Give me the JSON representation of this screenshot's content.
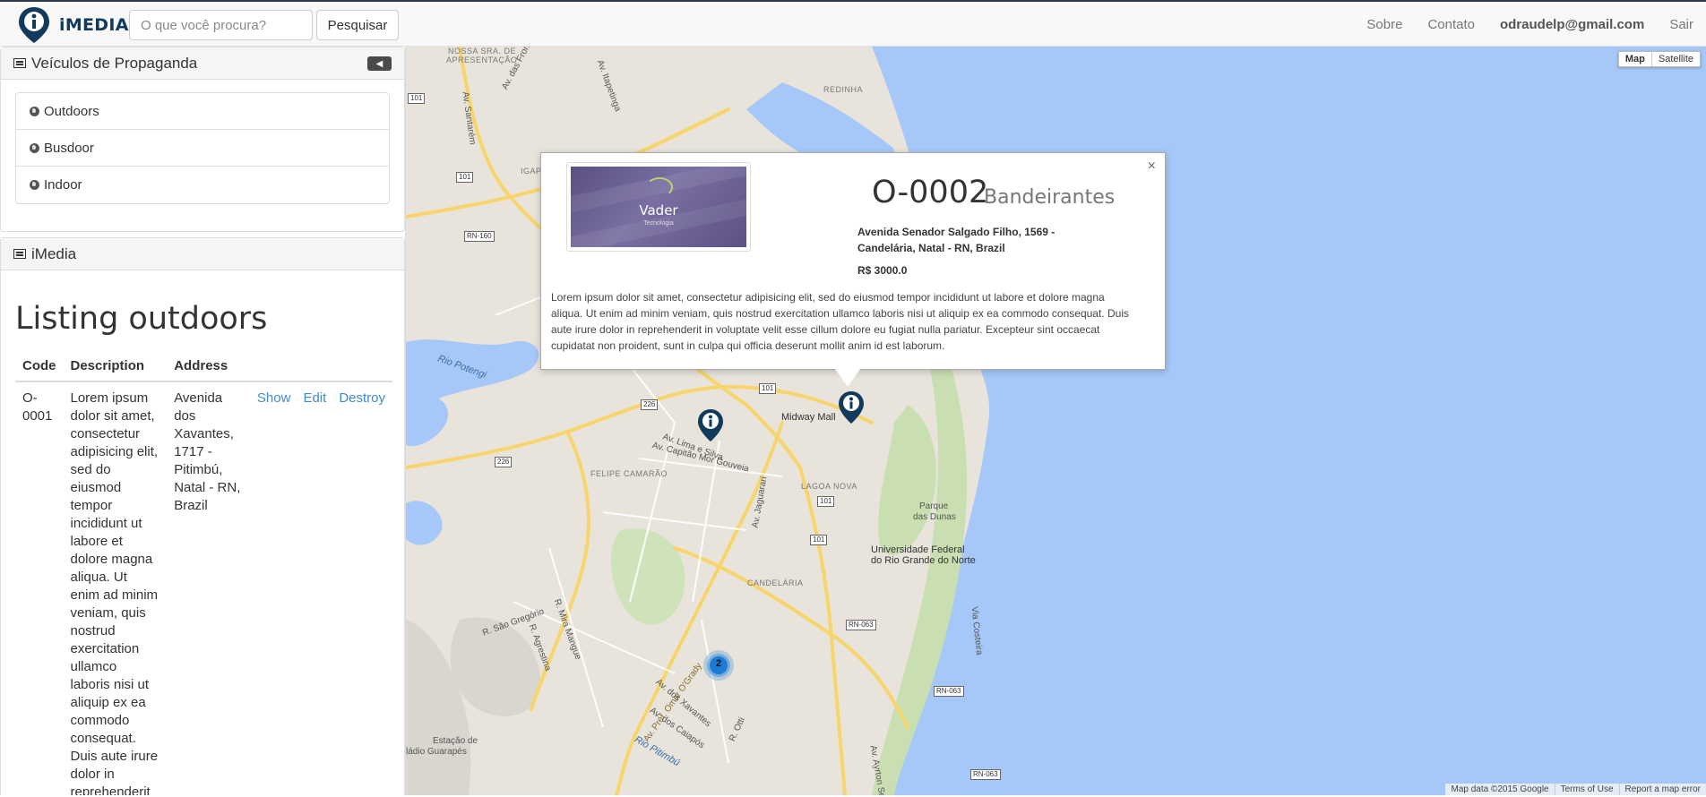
{
  "navbar": {
    "logo_text": "iMEDIA",
    "search_placeholder": "O que você procura?",
    "search_button": "Pesquisar",
    "links": {
      "about": "Sobre",
      "contact": "Contato",
      "user": "odraudelp@gmail.com",
      "logout": "Sair"
    }
  },
  "sidebar": {
    "vehicles_panel_title": "Veículos de Propaganda",
    "vehicles": [
      "Outdoors",
      "Busdoor",
      "Indoor"
    ],
    "imedia_panel_title": "iMedia",
    "page_title": "Listing outdoors",
    "table": {
      "headers": {
        "code": "Code",
        "description": "Description",
        "address": "Address"
      },
      "rows": [
        {
          "code": "O-0001",
          "description": "Lorem ipsum dolor sit amet, consectetur adipisicing elit, sed do eiusmod tempor incididunt ut labore et dolore magna aliqua. Ut enim ad minim veniam, quis nostrud exercitation ullamco laboris nisi ut aliquip ex ea commodo consequat. Duis aute irure dolor in reprehenderit",
          "address": "Avenida dos Xavantes, 1717 - Pitimbú, Natal - RN, Brazil",
          "actions": {
            "show": "Show",
            "edit": "Edit",
            "destroy": "Destroy"
          }
        }
      ]
    }
  },
  "map": {
    "type_controls": {
      "map": "Map",
      "satellite": "Satellite"
    },
    "footer": {
      "data": "Map data ©2015 Google",
      "terms": "Terms of Use",
      "report": "Report a map error"
    },
    "labels": {
      "nossa_senhora": "NOSSA SRA. DE",
      "apresentacao": "APRESENTAÇÃO",
      "redinha": "REDINHA",
      "igapo": "IGAPÓ",
      "av_santarem": "Av. Santarém",
      "av_das_fronteiras": "Av. das Fronteiras",
      "av_itapetinga": "Av. Itapetinga",
      "rio_potengi": "Rio Potengi",
      "midway_mall": "Midway Mall",
      "av_lima_e_silva": "Av. Lima e Silva",
      "av_capitao_mor_gouveia": "Av. Capitão Mor Gouveia",
      "felipe_camarao": "FELIPE\nCAMARÃO",
      "lagoa_nova": "LAGOA NOVA",
      "av_jaguarari": "Av. Jaguarari",
      "parque_das_dunas_1": "Parque",
      "parque_das_dunas_2": "das Dunas",
      "universidade_1": "Universidade Federal",
      "universidade_2": "do Rio Grande do Norte",
      "candelaria": "CANDELÁRIA",
      "r_sao_gregorio": "R. São Gregório",
      "r_mira_mangue": "R. Mira Mangue",
      "r_agrestina": "R. Agrestina",
      "av_prefeito_omar": "Av. Pref. Omar O'Grady",
      "av_dos_xavantes": "Av. dos Xavantes",
      "av_dos_caiapos": "Av. dos Caiapós",
      "rio_pitimbu": "Rio Pitimbú",
      "r_otti": "R. Otti",
      "estacao_1": "Estação de",
      "estacao_2": "ládio Guarapés",
      "via_costeira": "Via Costeira",
      "av_ayrton_senna": "Av. Ayrton Sen",
      "shields": [
        "101",
        "101",
        "101",
        "101",
        "101",
        "226",
        "226",
        "RN-160",
        "RN-063",
        "RN-063",
        "RN-063"
      ]
    },
    "cluster_count": "2"
  },
  "infowindow": {
    "close": "×",
    "image_brand": "Vader",
    "image_brand_sub": "Tecnologia",
    "code": "O-0002",
    "name": "Bandeirantes",
    "address": "Avenida Senador Salgado Filho, 1569 - Candelária, Natal - RN, Brazil",
    "price": "R$ 3000.0",
    "description": "Lorem ipsum dolor sit amet, consectetur adipisicing elit, sed do eiusmod tempor incididunt ut labore et dolore magna aliqua. Ut enim ad minim veniam, quis nostrud exercitation ullamco laboris nisi ut aliquip ex ea commodo consequat. Duis aute irure dolor in reprehenderit in voluptate velit esse cillum dolore eu fugiat nulla pariatur. Excepteur sint occaecat cupidatat non proident, sunt in culpa qui officia deserunt mollit anim id est laborum."
  }
}
